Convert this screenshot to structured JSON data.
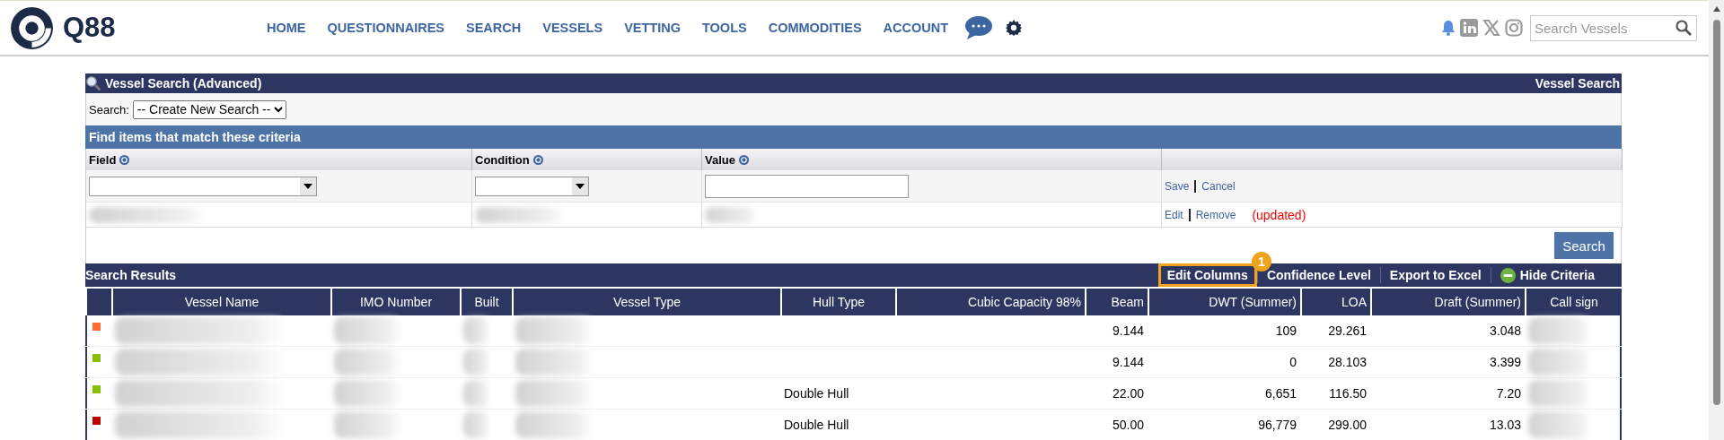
{
  "header": {
    "brand": "Q88",
    "nav": [
      "HOME",
      "QUESTIONNAIRES",
      "SEARCH",
      "VESSELS",
      "VETTING",
      "TOOLS",
      "COMMODITIES",
      "ACCOUNT"
    ],
    "search": {
      "placeholder": "Search Vessels"
    }
  },
  "panel": {
    "title": "Vessel Search (Advanced)",
    "title_right": "Vessel Search",
    "search_label": "Search:",
    "search_select": "-- Create New Search --",
    "criteria_title": "Find items that match these criteria",
    "criteria_columns": [
      "Field",
      "Condition",
      "Value"
    ],
    "edit_actions": [
      "Save",
      "Cancel"
    ],
    "row_actions": [
      "Edit",
      "Remove"
    ],
    "row_note": "(updated)",
    "search_button": "Search"
  },
  "results": {
    "title": "Search Results",
    "toolbar": [
      {
        "label": "Edit Columns",
        "highlighted": true,
        "badge": "1",
        "kind": "text"
      },
      {
        "label": "Confidence Level",
        "highlighted": false,
        "kind": "text"
      },
      {
        "label": "Export to Excel",
        "highlighted": false,
        "kind": "text"
      },
      {
        "label": "Hide Criteria",
        "highlighted": false,
        "kind": "icon"
      }
    ],
    "columns": [
      "Vessel Name",
      "IMO Number",
      "Built",
      "Vessel Type",
      "Hull Type",
      "Cubic Capacity 98%",
      "Beam",
      "DWT (Summer)",
      "LOA",
      "Draft (Summer)",
      "Call sign"
    ],
    "rows": [
      {
        "color": "#ff6a33",
        "beam": "9.144",
        "dwt": "109",
        "loa": "29.261",
        "draft": "3.048"
      },
      {
        "color": "#88c000",
        "beam": "9.144",
        "dwt": "0",
        "loa": "28.103",
        "draft": "3.399"
      },
      {
        "color": "#88c000",
        "hull_type": "Double Hull",
        "beam": "22.00",
        "dwt": "6,651",
        "loa": "116.50",
        "draft": "7.20"
      },
      {
        "color": "#c00000",
        "hull_type": "Double Hull",
        "beam": "50.00",
        "dwt": "96,779",
        "loa": "299.00",
        "draft": "13.03"
      }
    ]
  }
}
